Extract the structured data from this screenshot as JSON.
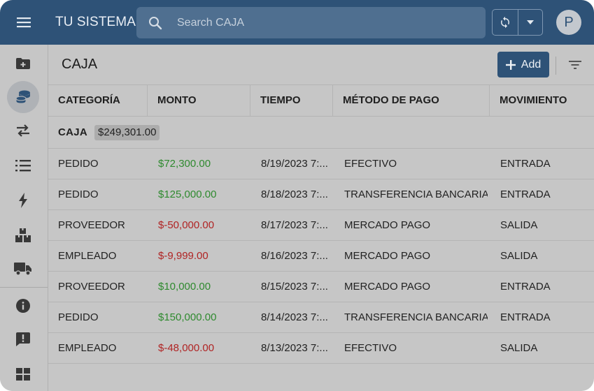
{
  "app": {
    "title": "TU SISTEMA"
  },
  "search": {
    "placeholder": "Search CAJA"
  },
  "user": {
    "initial": "P"
  },
  "icons": {
    "menu": "hamburger-menu-icon",
    "search": "search-icon",
    "sync": "sync-icon",
    "caret": "caret-down-icon",
    "add": "plus-icon",
    "filter": "filter-icon"
  },
  "sidebar": {
    "items": [
      {
        "name": "folder-plus",
        "active": false
      },
      {
        "name": "coins",
        "active": true
      },
      {
        "name": "transfer-arrows",
        "active": false
      },
      {
        "name": "list",
        "active": false
      },
      {
        "name": "lightning",
        "active": false
      },
      {
        "name": "boxes",
        "active": false
      },
      {
        "name": "truck",
        "active": false
      },
      {
        "name": "info",
        "active": false
      },
      {
        "name": "feedback",
        "active": false
      },
      {
        "name": "dashboard-grid",
        "active": false
      }
    ]
  },
  "page": {
    "title": "CAJA",
    "add_label": "Add"
  },
  "table": {
    "columns": [
      "CATEGORÍA",
      "MONTO",
      "TIEMPO",
      "MÉTODO DE PAGO",
      "MOVIMIENTO"
    ],
    "group": {
      "label": "CAJA",
      "total": "$249,301.00"
    },
    "rows": [
      {
        "categoria": "PEDIDO",
        "monto": "$72,300.00",
        "tiempo": "8/19/2023 7:...",
        "metodo": "EFECTIVO",
        "movimiento": "ENTRADA",
        "sign": "pos"
      },
      {
        "categoria": "PEDIDO",
        "monto": "$125,000.00",
        "tiempo": "8/18/2023 7:...",
        "metodo": "TRANSFERENCIA BANCARIA",
        "movimiento": "ENTRADA",
        "sign": "pos"
      },
      {
        "categoria": "PROVEEDOR",
        "monto": "$-50,000.00",
        "tiempo": "8/17/2023 7:...",
        "metodo": "MERCADO PAGO",
        "movimiento": "SALIDA",
        "sign": "neg"
      },
      {
        "categoria": "EMPLEADO",
        "monto": "$-9,999.00",
        "tiempo": "8/16/2023 7:...",
        "metodo": "MERCADO PAGO",
        "movimiento": "SALIDA",
        "sign": "neg"
      },
      {
        "categoria": "PROVEEDOR",
        "monto": "$10,000.00",
        "tiempo": "8/15/2023 7:...",
        "metodo": "MERCADO PAGO",
        "movimiento": "ENTRADA",
        "sign": "pos"
      },
      {
        "categoria": "PEDIDO",
        "monto": "$150,000.00",
        "tiempo": "8/14/2023 7:...",
        "metodo": "TRANSFERENCIA BANCARIA",
        "movimiento": "ENTRADA",
        "sign": "pos"
      },
      {
        "categoria": "EMPLEADO",
        "monto": "$-48,000.00",
        "tiempo": "8/13/2023 7:...",
        "metodo": "EFECTIVO",
        "movimiento": "SALIDA",
        "sign": "neg"
      }
    ]
  },
  "colors": {
    "brand": "#2e5277",
    "positive": "#2f8a2f",
    "negative": "#b02424",
    "overlay_gray": "#c6c6c6"
  }
}
